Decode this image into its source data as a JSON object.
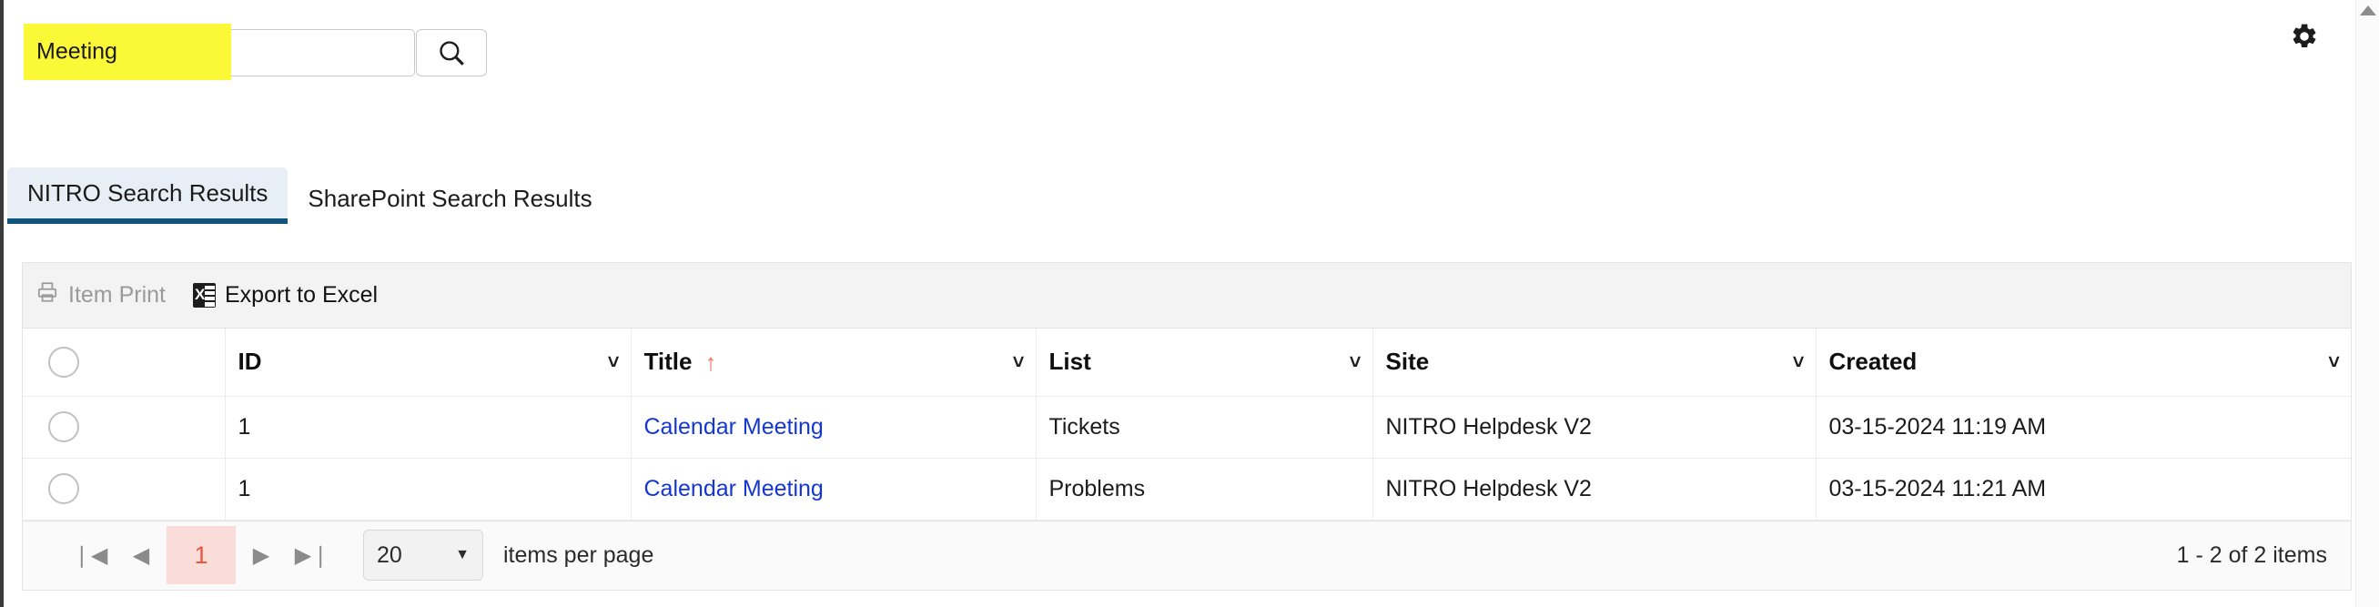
{
  "search": {
    "value": "Meeting",
    "placeholder": "",
    "highlight_color": "#fbf837",
    "button_icon": "search-icon"
  },
  "header": {
    "settings_icon": "gear-icon"
  },
  "tabs": [
    {
      "label": "NITRO Search Results",
      "active": true
    },
    {
      "label": "SharePoint Search Results",
      "active": false
    }
  ],
  "toolbar": {
    "item_print_label": "Item Print",
    "item_print_enabled": false,
    "export_excel_label": "Export to Excel",
    "export_excel_enabled": true
  },
  "table": {
    "sort": {
      "column": "Title",
      "direction": "asc",
      "arrow_color": "#f4705e"
    },
    "columns": [
      {
        "label": "ID"
      },
      {
        "label": "Title"
      },
      {
        "label": "List"
      },
      {
        "label": "Site"
      },
      {
        "label": "Created"
      }
    ],
    "rows": [
      {
        "id": "1",
        "title": "Calendar Meeting",
        "list": "Tickets",
        "site": "NITRO Helpdesk V2",
        "created": "03-15-2024 11:19 AM"
      },
      {
        "id": "1",
        "title": "Calendar Meeting",
        "list": "Problems",
        "site": "NITRO Helpdesk V2",
        "created": "03-15-2024 11:21 AM"
      }
    ]
  },
  "pager": {
    "first_icon": "first-page-icon",
    "prev_icon": "previous-page-icon",
    "current_page": "1",
    "next_icon": "next-page-icon",
    "last_icon": "last-page-icon",
    "page_size": "20",
    "items_per_page_label": "items per page",
    "range_info": "1 - 2 of 2 items",
    "current_page_bg": "#fadcd9",
    "current_page_color": "#e8573f"
  }
}
